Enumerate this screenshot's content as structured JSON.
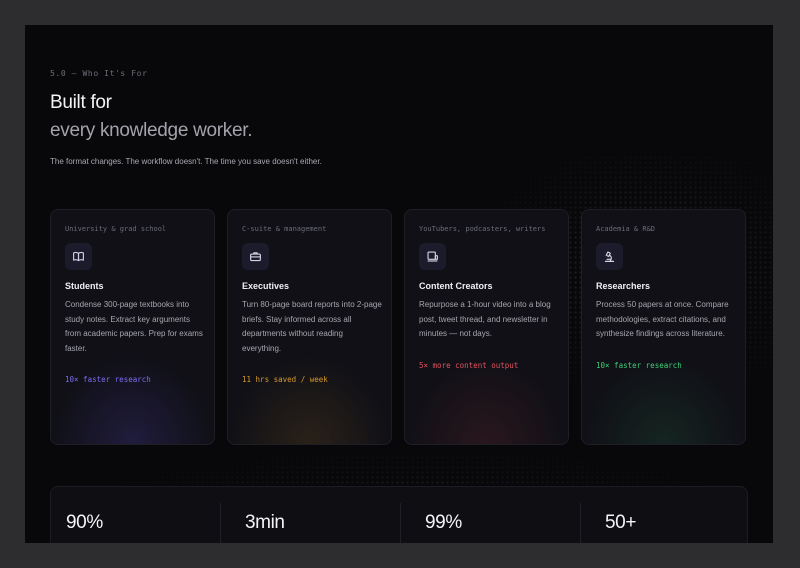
{
  "section": {
    "eyebrow": "5.0 — Who It's For",
    "heading_line1": "Built for",
    "heading_line2": "every knowledge worker.",
    "subtitle": "The format changes. The workflow doesn't. The time you save doesn't either."
  },
  "cards": [
    {
      "tag": "University & grad school",
      "icon": "book-icon",
      "title": "Students",
      "description": "Condense 300-page textbooks into study notes. Extract key arguments from academic papers. Prep for exams faster.",
      "stat": "10× faster research",
      "accent": "#7b6cf0"
    },
    {
      "tag": "C-suite & management",
      "icon": "briefcase-icon",
      "title": "Executives",
      "description": "Turn 80-page board reports into 2-page briefs. Stay informed across all departments without reading everything.",
      "stat": "11 hrs saved / week",
      "accent": "#d99a2b"
    },
    {
      "tag": "YouTubers, podcasters, writers",
      "icon": "device-icon",
      "title": "Content Creators",
      "description": "Repurpose a 1-hour video into a blog post, tweet thread, and newsletter in minutes — not days.",
      "stat": "5× more content output",
      "accent": "#e0525f"
    },
    {
      "tag": "Academia & R&D",
      "icon": "microscope-icon",
      "title": "Researchers",
      "description": "Process 50 papers at once. Compare methodologies, extract citations, and synthesize findings across literature.",
      "stat": "10× faster research",
      "accent": "#3ecf7a"
    }
  ],
  "stats": [
    {
      "value": "90%"
    },
    {
      "value": "3min"
    },
    {
      "value": "99%"
    },
    {
      "value": "50+"
    }
  ]
}
